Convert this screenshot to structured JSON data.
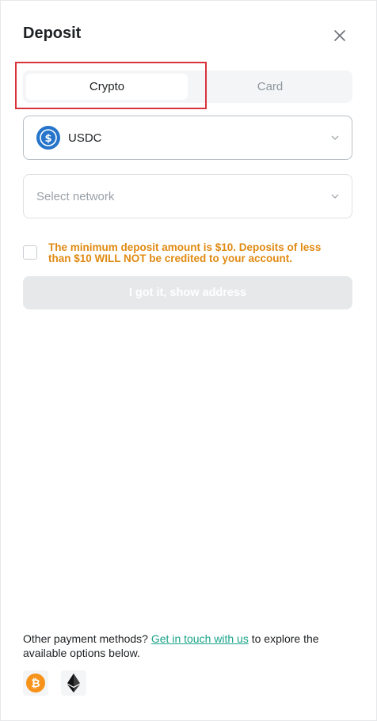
{
  "header": {
    "title": "Deposit",
    "close_icon": "close-icon"
  },
  "tabs": [
    {
      "label": "Crypto",
      "active": true
    },
    {
      "label": "Card",
      "active": false
    }
  ],
  "asset_select": {
    "selected": "USDC",
    "icon": "usdc-coin-icon",
    "color": "#2775CA"
  },
  "network_select": {
    "placeholder": "Select network"
  },
  "notice": {
    "text": "The minimum deposit amount is $10. Deposits of less than $10 WILL NOT be credited to your account.",
    "color": "#E08A12",
    "checked": false
  },
  "show_button": {
    "label": "I got it, show address",
    "disabled": true
  },
  "footer": {
    "prefix": "Other payment methods? ",
    "link": "Get in touch with us",
    "suffix": " to explore the available options below."
  },
  "payment_icons": [
    {
      "name": "bitcoin-icon",
      "color": "#F7931A"
    },
    {
      "name": "ethereum-icon",
      "color": "#3C3C3D"
    }
  ],
  "colors": {
    "highlight": "#D8343C",
    "link": "#1AA38A"
  }
}
